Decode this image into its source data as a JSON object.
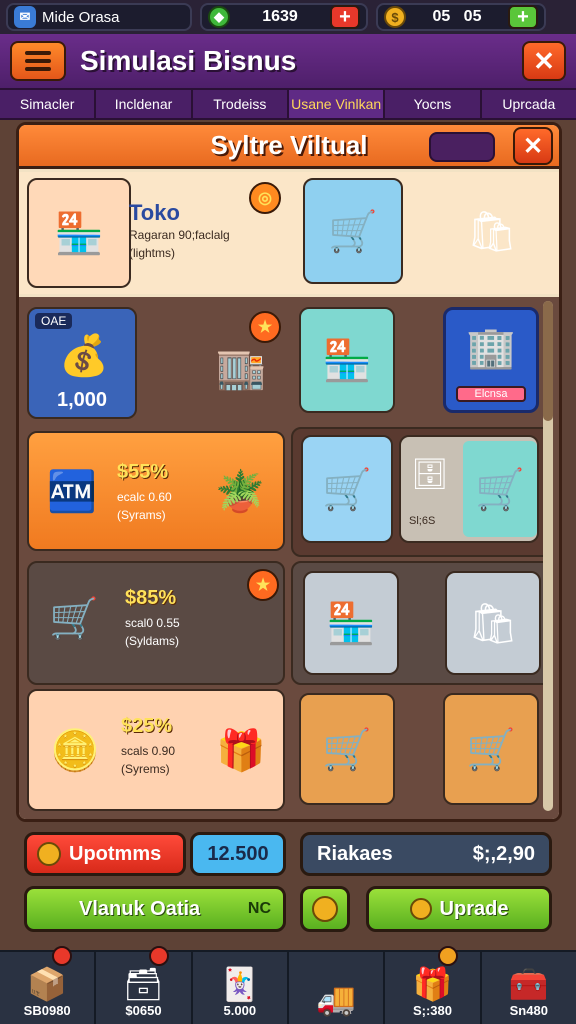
{
  "topbar": {
    "profile_name": "Mide Orasa",
    "gems": "1639",
    "coins": "05   05"
  },
  "header": {
    "title": "Simulasi Bisnus"
  },
  "tabs": [
    {
      "label": "Simacler"
    },
    {
      "label": "Incldenar"
    },
    {
      "label": "Trodeiss"
    },
    {
      "label": "Usane Vinlkan"
    },
    {
      "label": "Yocns"
    },
    {
      "label": "Uprcada"
    }
  ],
  "panel": {
    "title": "Syltre Viltual"
  },
  "cards": {
    "toko": {
      "name": "Toko",
      "line1": "Ragaran 90;faclalg",
      "line2": "(lightms)"
    },
    "bank": {
      "tag": "OAE",
      "value": "1,000"
    },
    "crate_store": {
      "label": "Elcnsa"
    },
    "cart_small": {
      "label": "Sl;6S"
    },
    "deal1": {
      "percent": "$55%",
      "line1": "ecalc 0.60",
      "line2": "(Syrams)"
    },
    "deal2": {
      "percent": "$85%",
      "line1": "scal0 0.55",
      "line2": "(Syldams)"
    },
    "deal3": {
      "percent": "$25%",
      "line1": "scals 0.90",
      "line2": "(Syrems)"
    }
  },
  "actions": {
    "upgrades_label": "Upotmms",
    "upgrades_value": "12.500",
    "rikaes_label": "Riakaes",
    "rikaes_value": "$;,2,90",
    "left_green_label": "Vlanuk Oatia",
    "left_green_tag": "NC",
    "upgrade_label": "Uprade"
  },
  "dock": [
    {
      "label": "SB0980"
    },
    {
      "label": "$0650"
    },
    {
      "label": "5.000"
    },
    {
      "label": ""
    },
    {
      "label": "S;:380"
    },
    {
      "label": "Sn480"
    }
  ],
  "colors": {
    "accent_orange": "#f07a2a",
    "purple": "#5a2580",
    "green": "#7ccf2a"
  }
}
